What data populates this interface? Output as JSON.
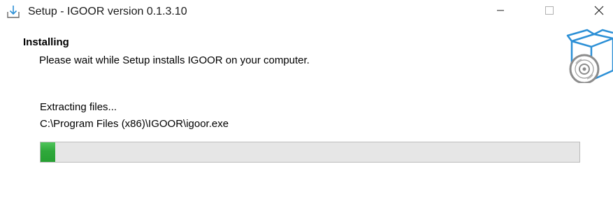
{
  "window": {
    "title": "Setup - IGOOR version 0.1.3.10",
    "icon": "installer-download-icon"
  },
  "controls": {
    "minimize_icon": "minimize-icon",
    "maximize_icon": "maximize-icon",
    "close_icon": "close-icon"
  },
  "header": {
    "title": "Installing",
    "subtitle": "Please wait while Setup installs IGOOR on your computer.",
    "graphic": "box-with-disc-icon"
  },
  "progress": {
    "status": "Extracting files...",
    "current_file": "C:\\Program Files (x86)\\IGOOR\\igoor.exe",
    "fraction": 0.027
  },
  "colors": {
    "progress_fill": "#2fa83b",
    "progress_track": "#e6e6e6",
    "graphic_accent": "#2b8fd6"
  }
}
